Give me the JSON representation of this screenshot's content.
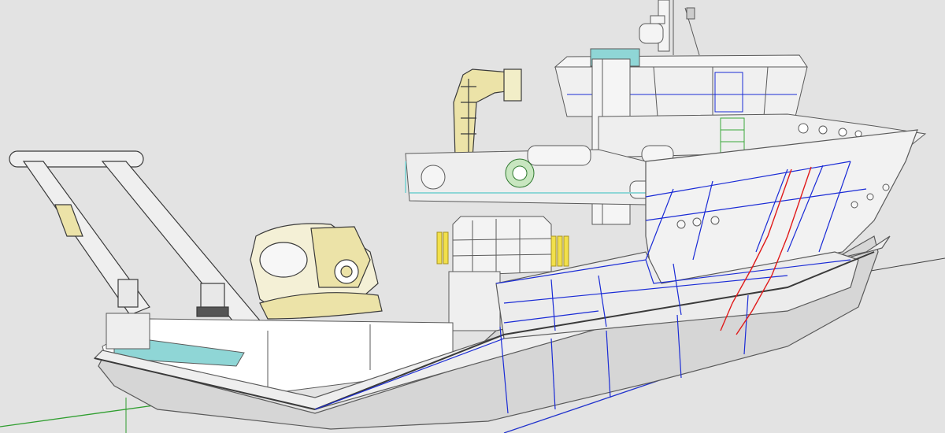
{
  "viewport": {
    "background": "#e3e3e3",
    "label": ""
  },
  "colors": {
    "hull_fill": "#f2f2f2",
    "hull_shadow": "#d6d6d6",
    "edge": "#5a5a5a",
    "wire_blue": "#1a2bd6",
    "wire_red": "#e01a1a",
    "wire_green": "#39a83a",
    "crane_yellow": "#ece3a8",
    "deck_teal": "#8fd6d6",
    "axis_green": "#2f9e2f",
    "axis_blue": "#2233cc"
  },
  "icons": {
    "axis": "world-axis-icon"
  }
}
